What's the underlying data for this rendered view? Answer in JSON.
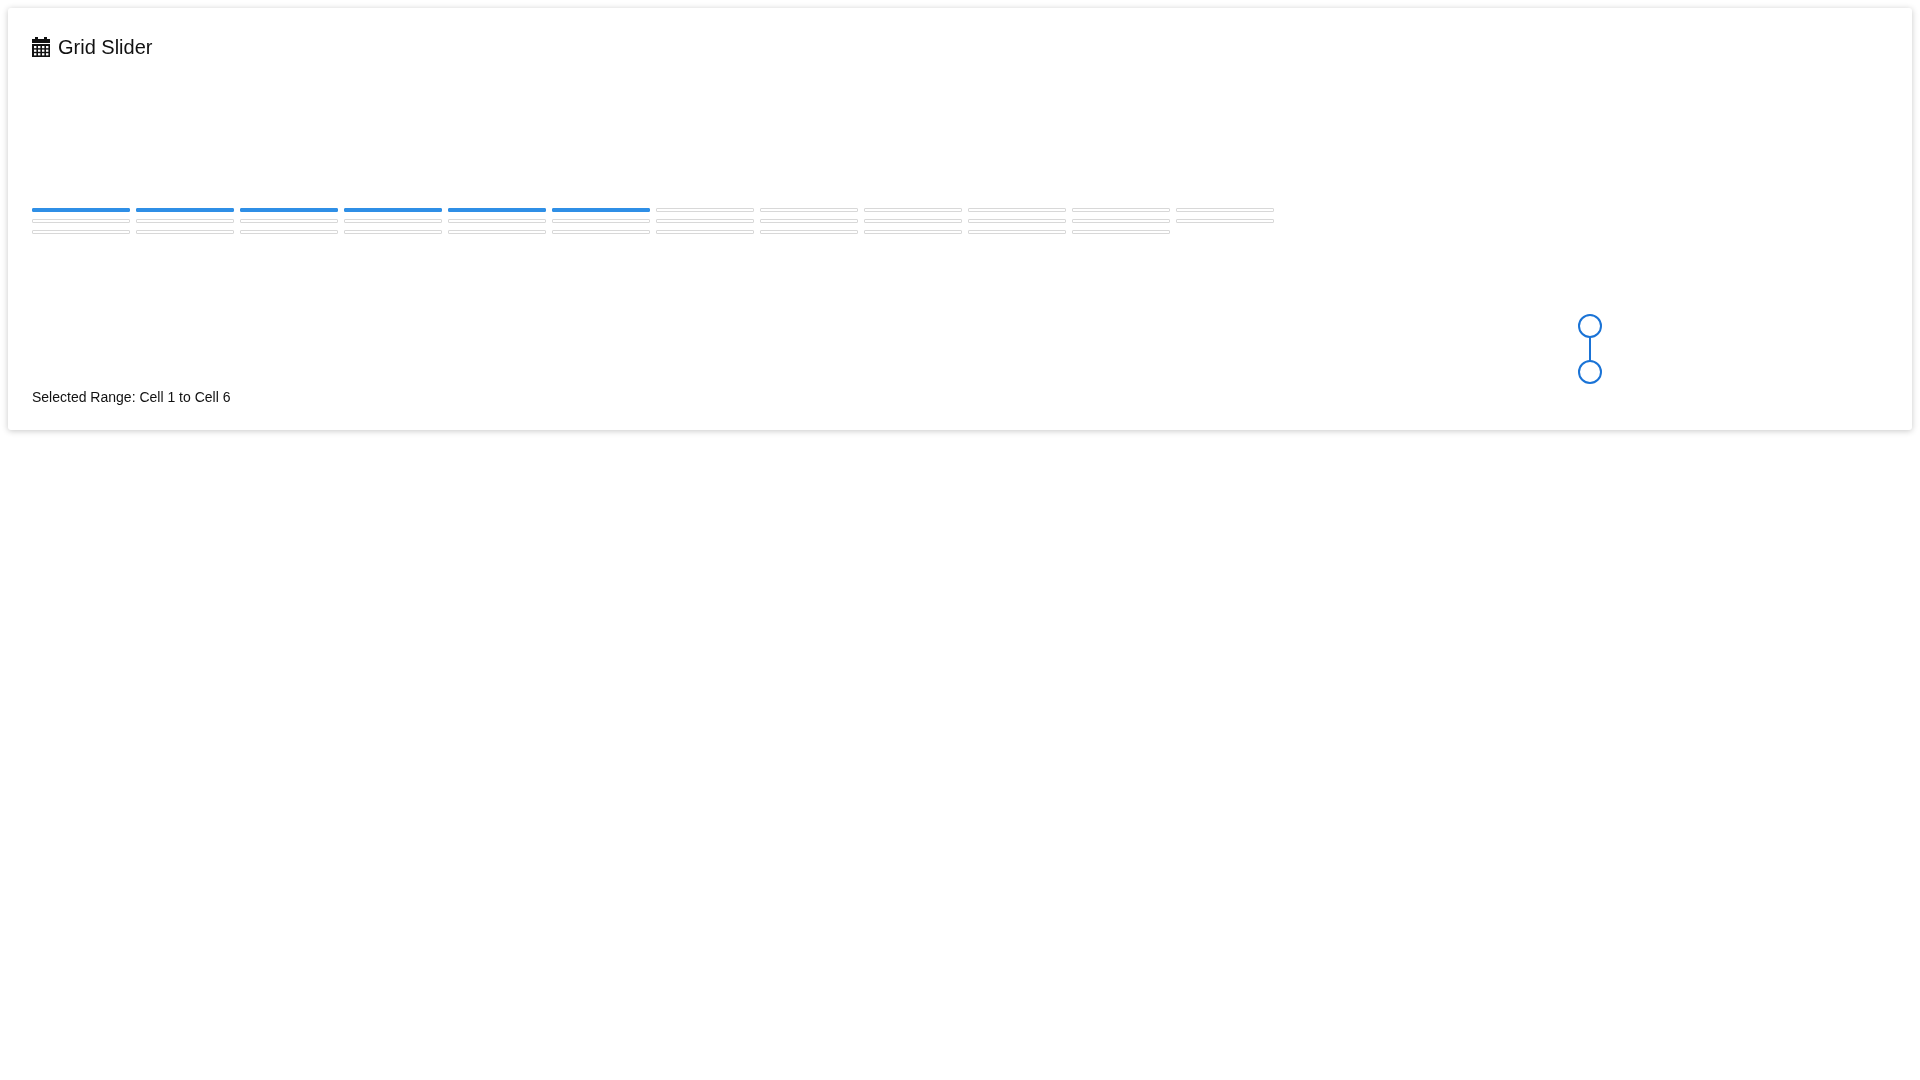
{
  "title": "Grid Slider",
  "grid": [
    {
      "cells": [
        {
          "selected": true
        },
        {
          "selected": true
        },
        {
          "selected": true
        },
        {
          "selected": true
        },
        {
          "selected": true
        },
        {
          "selected": true
        },
        {
          "selected": false
        },
        {
          "selected": false
        },
        {
          "selected": false
        },
        {
          "selected": false
        },
        {
          "selected": false
        },
        {
          "selected": false
        }
      ]
    },
    {
      "cells": [
        {
          "selected": false
        },
        {
          "selected": false
        },
        {
          "selected": false
        },
        {
          "selected": false
        },
        {
          "selected": false
        },
        {
          "selected": false
        },
        {
          "selected": false
        },
        {
          "selected": false
        },
        {
          "selected": false
        },
        {
          "selected": false
        },
        {
          "selected": false
        },
        {
          "selected": false
        }
      ]
    },
    {
      "cells": [
        {
          "selected": false
        },
        {
          "selected": false
        },
        {
          "selected": false
        },
        {
          "selected": false
        },
        {
          "selected": false
        },
        {
          "selected": false
        },
        {
          "selected": false
        },
        {
          "selected": false
        },
        {
          "selected": false
        },
        {
          "selected": false
        },
        {
          "selected": false
        }
      ]
    }
  ],
  "status": "Selected Range: Cell 1 to Cell 6"
}
